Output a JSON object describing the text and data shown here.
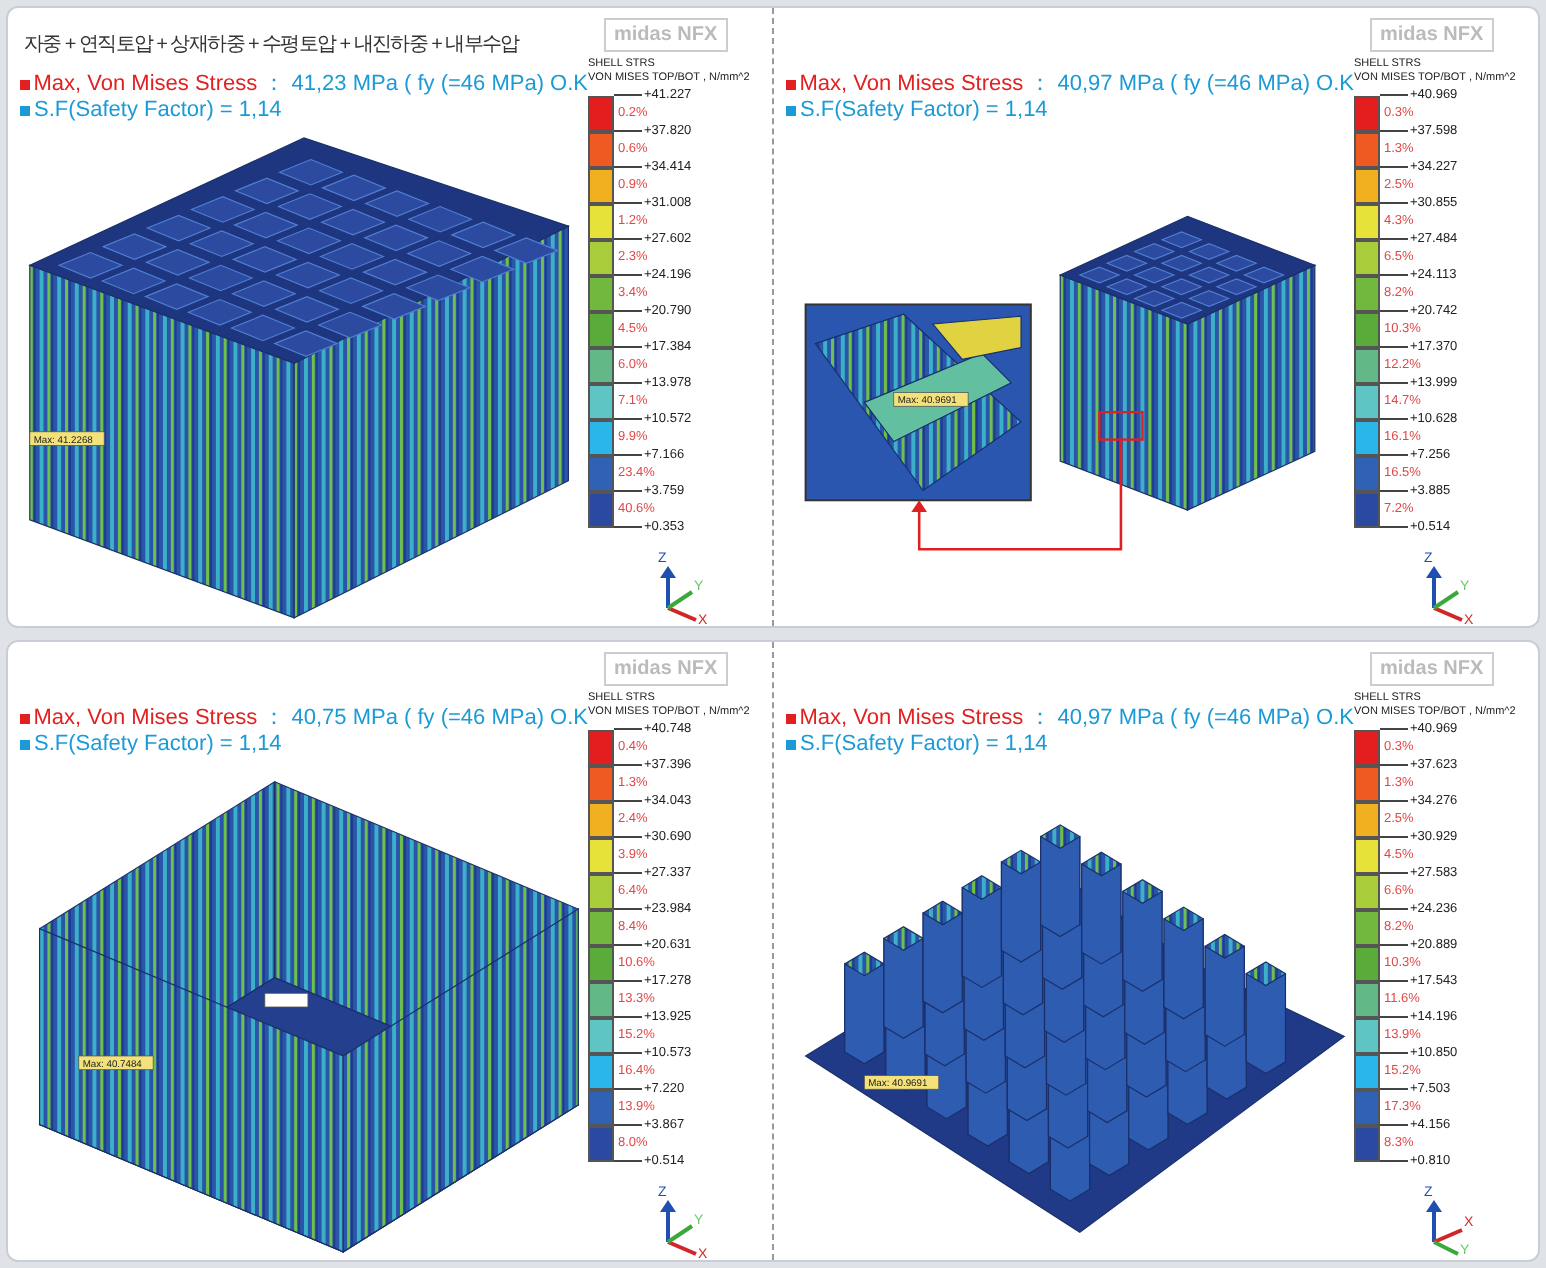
{
  "boxes": [
    {
      "panels": [
        {
          "title": "자중 + 연직토압 + 상재하중 + 수평토압 + 내진하중 + 내부수압",
          "stress_label": "Max, Von Mises Stress",
          "stress_value": "： 41,23 MPa ( fy (=46 MPa)  O.K",
          "safety": "S.F(Safety Factor) = 1,14",
          "model": {
            "kind": "box-grid",
            "max_label": "Max: 41.2268"
          },
          "legend": {
            "logo": "midas NFX",
            "title_1": "SHELL STRS",
            "title_2": "VON MISES TOP/BOT , N/mm^2",
            "ticks": [
              "+41.227",
              "+37.820",
              "+34.414",
              "+31.008",
              "+27.602",
              "+24.196",
              "+20.790",
              "+17.384",
              "+13.978",
              "+10.572",
              "+7.166",
              "+3.759",
              "+0.353"
            ],
            "percents": [
              "0.2%",
              "0.6%",
              "0.9%",
              "1.2%",
              "2.3%",
              "3.4%",
              "4.5%",
              "6.0%",
              "7.1%",
              "9.9%",
              "23.4%",
              "40.6%"
            ]
          },
          "triad": {
            "kind": "standard",
            "labels": [
              "Z",
              "Y",
              "X"
            ]
          }
        },
        {
          "stress_label": "Max, Von Mises Stress",
          "stress_value": "： 40,97 MPa ( fy (=46 MPa)  O.K",
          "safety": "S.F(Safety Factor) = 1,14",
          "model": {
            "kind": "box-inset",
            "max_label": "Max: 40.9691"
          },
          "legend": {
            "logo": "midas NFX",
            "title_1": "SHELL STRS",
            "title_2": "VON MISES TOP/BOT , N/mm^2",
            "ticks": [
              "+40.969",
              "+37.598",
              "+34.227",
              "+30.855",
              "+27.484",
              "+24.113",
              "+20.742",
              "+17.370",
              "+13.999",
              "+10.628",
              "+7.256",
              "+3.885",
              "+0.514"
            ],
            "percents": [
              "0.3%",
              "1.3%",
              "2.5%",
              "4.3%",
              "6.5%",
              "8.2%",
              "10.3%",
              "12.2%",
              "14.7%",
              "16.1%",
              "16.5%",
              "7.2%"
            ]
          },
          "triad": {
            "kind": "standard",
            "labels": [
              "Z",
              "Y",
              "X"
            ]
          }
        }
      ]
    },
    {
      "panels": [
        {
          "stress_label": "Max, Von Mises Stress",
          "stress_value": "： 40,75 MPa ( fy (=46 MPa)  O.K",
          "safety": "S.F(Safety Factor) = 1,14",
          "model": {
            "kind": "open-walls",
            "max_label": "Max: 40.7484"
          },
          "legend": {
            "logo": "midas NFX",
            "title_1": "SHELL STRS",
            "title_2": "VON MISES TOP/BOT , N/mm^2",
            "ticks": [
              "+40.748",
              "+37.396",
              "+34.043",
              "+30.690",
              "+27.337",
              "+23.984",
              "+20.631",
              "+17.278",
              "+13.925",
              "+10.573",
              "+7.220",
              "+3.867",
              "+0.514"
            ],
            "percents": [
              "0.4%",
              "1.3%",
              "2.4%",
              "3.9%",
              "6.4%",
              "8.4%",
              "10.6%",
              "13.3%",
              "15.2%",
              "16.4%",
              "13.9%",
              "8.0%"
            ]
          },
          "triad": {
            "kind": "standard",
            "labels": [
              "Z",
              "Y",
              "X"
            ]
          }
        },
        {
          "stress_label": "Max, Von Mises Stress",
          "stress_value": "： 40,97 MPa ( fy (=46 MPa)  O.K",
          "safety": "S.F(Safety Factor) = 1,14",
          "model": {
            "kind": "hex-walls",
            "max_label": "Max: 40.9691"
          },
          "legend": {
            "logo": "midas NFX",
            "title_1": "SHELL STRS",
            "title_2": "VON MISES TOP/BOT , N/mm^2",
            "ticks": [
              "+40.969",
              "+37.623",
              "+34.276",
              "+30.929",
              "+27.583",
              "+24.236",
              "+20.889",
              "+17.543",
              "+14.196",
              "+10.850",
              "+7.503",
              "+4.156",
              "+0.810"
            ],
            "percents": [
              "0.3%",
              "1.3%",
              "2.5%",
              "4.5%",
              "6.6%",
              "8.2%",
              "10.3%",
              "11.6%",
              "13.9%",
              "15.2%",
              "17.3%",
              "8.3%"
            ]
          },
          "triad": {
            "kind": "rotated",
            "labels": [
              "Z",
              "Y",
              "X"
            ]
          }
        }
      ]
    }
  ]
}
